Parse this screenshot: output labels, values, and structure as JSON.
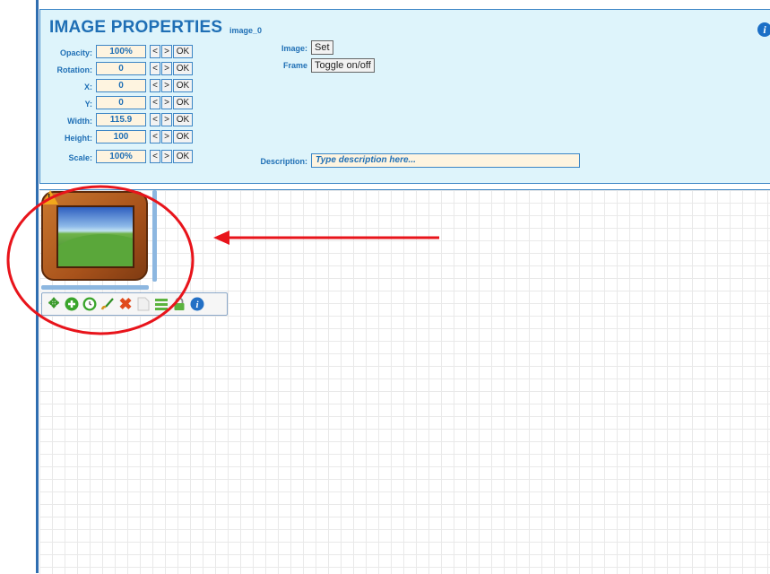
{
  "panel": {
    "title": "IMAGE PROPERTIES",
    "subtitle": "image_0",
    "info_icon": "info-icon"
  },
  "properties": [
    {
      "label": "Opacity:",
      "value": "100%"
    },
    {
      "label": "Rotation:",
      "value": "0"
    },
    {
      "label": "X:",
      "value": "0"
    },
    {
      "label": "Y:",
      "value": "0"
    },
    {
      "label": "Width:",
      "value": "115.9"
    },
    {
      "label": "Height:",
      "value": "100"
    },
    {
      "label": "Scale:",
      "value": "100%"
    }
  ],
  "buttons": {
    "decrease": "<",
    "increase": ">",
    "ok": "OK"
  },
  "image": {
    "label": "Image:",
    "button": "Set"
  },
  "frame": {
    "label": "Frame",
    "button": "Toggle on/off"
  },
  "description": {
    "label": "Description:",
    "placeholder": "Type description here..."
  },
  "toolbar_icons": [
    "move-icon",
    "add-icon",
    "clock-icon",
    "brush-icon",
    "delete-icon",
    "blank-icon",
    "menu-icon",
    "lock-icon",
    "info-icon"
  ],
  "colors": {
    "accent": "#1f6fb5",
    "panel_bg": "#def4fb",
    "annotation": "#e8141b",
    "field_bg": "#fef4e0"
  }
}
